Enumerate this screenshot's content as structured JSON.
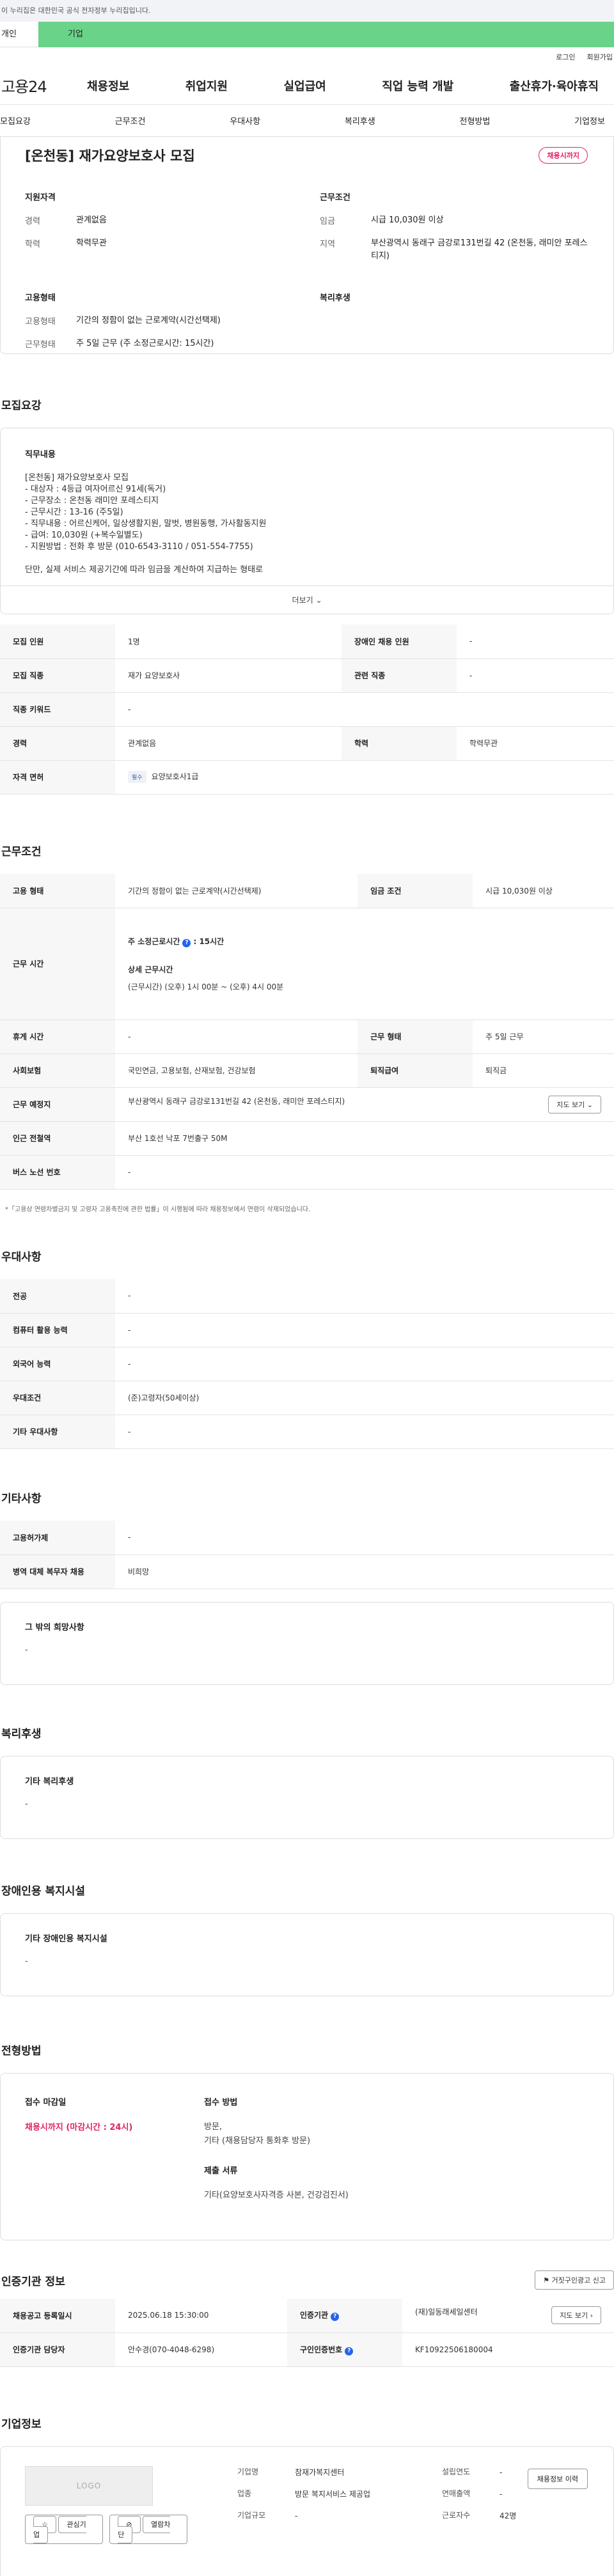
{
  "gov_banner": "이 누리집은 대한민국 공식 전자정부 누리집입니다.",
  "tabs": [
    "개인",
    "기업"
  ],
  "util": [
    "로그인",
    "회원가입"
  ],
  "logo": "고용24",
  "gnb": [
    "채용정보",
    "취업지원",
    "실업급여",
    "직업 능력 개발",
    "출산휴가·육아휴직"
  ],
  "anchors": [
    "모집요강",
    "근무조건",
    "우대사항",
    "복리후생",
    "전형방법",
    "기업정보"
  ],
  "summary": {
    "title": "[온천동] 재가요양보호사 모집",
    "status_badge": "채용시까지",
    "qual_title": "지원자격",
    "qual_career_k": "경력",
    "qual_career_v": "관계없음",
    "qual_edu_k": "학력",
    "qual_edu_v": "학력무관",
    "cond_title": "근무조건",
    "cond_wage_k": "임금",
    "cond_wage_v": "시급 10,030원 이상",
    "cond_area_k": "지역",
    "cond_area_v": "부산광역시 동래구 금강로131번길 42 (온천동, 래미안 포레스티지)",
    "emp_title": "고용형태",
    "emp_type_k": "고용형태",
    "emp_type_v": "기간의 정함이 없는 근로계약(시간선택제)",
    "emp_hours_k": "근무형태",
    "emp_hours_v": "주 5일 근무 (주 소정근로시간: 15시간)",
    "welfare_title": "복리후생"
  },
  "recruit": {
    "section": "모집요강",
    "duty_title": "직무내용",
    "lines": [
      "[온천동] 재가요양보호사 모집",
      "- 대상자 : 4등급 여자어르신 91세(독거)",
      "- 근무장소 : 온천동 래미안 포레스티지",
      "- 근무시간 : 13-16 (주5일)",
      "- 직무내용 : 어르신케어, 일상생활지원, 말벗, 병원동행, 가사활동지원",
      "- 급여: 10,030원 (+복수일별도)",
      "- 지원방법 :  전화 후 방문 (010-6543-3110 / 051-554-7755)",
      "",
      "단만, 실제 서비스 제공기간에 따라 임금을 계산하여 지급하는 형태로"
    ],
    "more": "더보기",
    "table": {
      "count_k": "모집 인원",
      "count_v": "1명",
      "disabled_k": "장애인 채용 인원",
      "disabled_v": "-",
      "job_k": "모집 직종",
      "job_v": "재가 요양보호사",
      "related_k": "관련 직종",
      "related_v": "-",
      "keyword_k": "직종 키워드",
      "keyword_v": "-",
      "career_k": "경력",
      "career_v": "관계없음",
      "edu_k": "학력",
      "edu_v": "학력무관",
      "license_k": "자격 면허",
      "license_tag": "필수",
      "license_v": "요양보호사1급"
    }
  },
  "work": {
    "section": "근무조건",
    "emp_k": "고용 형태",
    "emp_v": "기간의 정함이 없는 근로계약(시간선택제)",
    "wage_k": "임금 조건",
    "wage_v": "시급 10,030원 이상",
    "hours_k": "근무 시간",
    "hours_l1": "주 소정근로시간",
    "hours_l1_v": ": 15시간",
    "hours_l2": "상세 근무시간",
    "hours_l3": "(근무시간) (오후) 1시 00분 ~ (오후) 4시 00분",
    "rest_k": "휴게 시간",
    "rest_v": "-",
    "form_k": "근무 형태",
    "form_v": "주 5일 근무",
    "ins_k": "사회보험",
    "ins_v": "국민연금, 고용보험, 산재보험, 건강보험",
    "sev_k": "퇴직급여",
    "sev_v": "퇴직금",
    "place_k": "근무 예정지",
    "place_v": "부산광역시 동래구 금강로131번길 42 (온천동, 래미안 포레스티지)",
    "map_btn": "지도 보기",
    "station_k": "인근 전철역",
    "station_v": "부산 1호선 낙포 7번출구 50M",
    "bus_k": "버스 노선 번호",
    "bus_v": "-",
    "note": "*「고용상 연령차별금지 및 고령자 고용촉진에 관한 법률」이 시행됨에 따라 채용정보에서 연령이 삭제되었습니다."
  },
  "pref": {
    "section": "우대사항",
    "major_k": "전공",
    "major_v": "-",
    "pc_k": "컴퓨터 활용 능력",
    "pc_v": "-",
    "lang_k": "외국어 능력",
    "lang_v": "-",
    "cond_k": "우대조건",
    "cond_v": "(준)고령자(50세이상)",
    "etc_k": "기타 우대사항",
    "etc_v": "-"
  },
  "other": {
    "section": "기타사항",
    "hire_k": "고용허가제",
    "hire_v": "-",
    "army_k": "병역 대체 복무자 채용",
    "army_v": "비희망",
    "wish_title": "그 밖의 희망사항",
    "wish_v": "-"
  },
  "welfare": {
    "section": "복리후생",
    "title": "기타 복리후생",
    "v": "-"
  },
  "disabled_fac": {
    "section": "장애인용 복지시설",
    "title": "기타 장애인용 복지시설",
    "v": "-"
  },
  "process": {
    "section": "전형방법",
    "deadline_t": "접수 마감일",
    "deadline_v": "채용시까지 (마감시간 : 24시)",
    "method_t": "접수 방법",
    "method_v1": "방문,",
    "method_v2": "기타 (채용담당자 통화후 방문)",
    "docs_t": "제출 서류",
    "docs_v": "기타(요양보호사자격증 사본, 건강검진서)"
  },
  "cert": {
    "section": "인증기관 정보",
    "report_btn": "거짓구인광고 신고",
    "reg_k": "채용공고 등록일시",
    "reg_v": "2025.06.18 15:30:00",
    "org_k": "인증기관",
    "org_v": "(재)일동래세일센터",
    "map_btn": "지도 보기",
    "mgr_k": "인증기관 담당자",
    "mgr_v": "안수경(070-4048-6298)",
    "num_k": "구인인증번호",
    "num_v": "KF10922506180004"
  },
  "company": {
    "section": "기업정보",
    "logo": "LOGO",
    "fav_btn": "관심기업",
    "block_btn": "열람차단",
    "name_k": "기업명",
    "name_v": "참재가복지센터",
    "year_k": "설립연도",
    "year_v": "-",
    "ind_k": "업종",
    "ind_v": "방문 복지서비스 제공업",
    "sales_k": "연매출액",
    "sales_v": "-",
    "emp_k": "근로자수",
    "emp_v": "42명",
    "size_k": "기업규모",
    "size_v": "-",
    "rec_btn": "채용정보 이력"
  }
}
